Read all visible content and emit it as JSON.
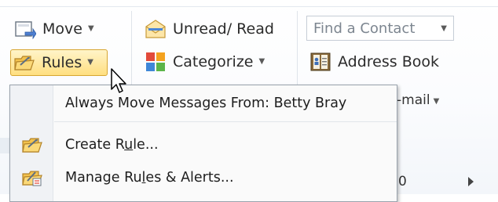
{
  "ribbon": {
    "move_label": "Move",
    "rules_label": "Rules",
    "unread_read_label": "Unread/ Read",
    "categorize_label": "Categorize",
    "find_contact_placeholder": "Find a Contact",
    "address_book_label": "Address Book",
    "email_partial_label": "-mail",
    "partial_zero": "0"
  },
  "rules_menu": {
    "always_move_label": "Always Move Messages From: Betty Bray",
    "create_rule": {
      "before": "Create R",
      "underlined": "u",
      "after": "le..."
    },
    "manage_rules": {
      "before": "Manage Ru",
      "underlined": "l",
      "after": "es & Alerts..."
    }
  },
  "icons": {
    "move": "move-folder-icon",
    "rules": "rules-folder-icon",
    "unread_read": "envelope-icon",
    "categorize": "color-grid-icon",
    "address_book": "address-book-icon",
    "create_rule": "create-rule-icon",
    "manage_rules": "manage-rules-icon",
    "dropdown": "caret-down-icon",
    "cursor": "mouse-cursor-icon"
  },
  "colors": {
    "hover_highlight": "#ffdf80",
    "hover_border": "#d7a632",
    "menu_border": "#9aa3ad"
  }
}
